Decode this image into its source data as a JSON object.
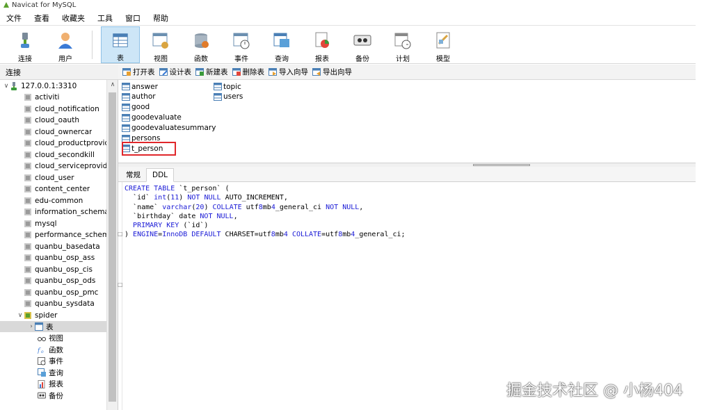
{
  "window": {
    "title": "Navicat for MySQL"
  },
  "menu": [
    "文件",
    "查看",
    "收藏夹",
    "工具",
    "窗口",
    "帮助"
  ],
  "toolbar": {
    "buttons": [
      {
        "label": "连接",
        "icon": "connect-icon"
      },
      {
        "label": "用户",
        "icon": "user-icon"
      },
      {
        "label": "表",
        "icon": "table-icon",
        "active": true
      },
      {
        "label": "视图",
        "icon": "view-icon"
      },
      {
        "label": "函数",
        "icon": "function-icon"
      },
      {
        "label": "事件",
        "icon": "event-icon"
      },
      {
        "label": "查询",
        "icon": "query-icon"
      },
      {
        "label": "报表",
        "icon": "report-icon"
      },
      {
        "label": "备份",
        "icon": "backup-icon"
      },
      {
        "label": "计划",
        "icon": "schedule-icon"
      },
      {
        "label": "模型",
        "icon": "model-icon"
      }
    ]
  },
  "navigator": {
    "header": "连接",
    "connection": "127.0.0.1:3310",
    "databases": [
      "activiti",
      "cloud_notification",
      "cloud_oauth",
      "cloud_ownercar",
      "cloud_productprovic",
      "cloud_secondkill",
      "cloud_serviceprovide",
      "cloud_user",
      "content_center",
      "edu-common",
      "information_schema",
      "mysql",
      "performance_schem",
      "quanbu_basedata",
      "quanbu_osp_ass",
      "quanbu_osp_cis",
      "quanbu_osp_ods",
      "quanbu_osp_pmc",
      "quanbu_sysdata"
    ],
    "open_database": "spider",
    "children": [
      {
        "label": "表",
        "icon": "table-icon"
      },
      {
        "label": "视图",
        "icon": "view-icon"
      },
      {
        "label": "函数",
        "icon": "function-icon"
      },
      {
        "label": "事件",
        "icon": "event-icon"
      },
      {
        "label": "查询",
        "icon": "query-icon"
      },
      {
        "label": "报表",
        "icon": "report-icon"
      },
      {
        "label": "备份",
        "icon": "backup-icon"
      }
    ]
  },
  "object_toolbar": [
    "打开表",
    "设计表",
    "新建表",
    "删除表",
    "导入向导",
    "导出向导"
  ],
  "tables": {
    "col1": [
      "answer",
      "author",
      "good",
      "goodevaluate",
      "goodevaluatesummary",
      "persons",
      "t_person"
    ],
    "col2": [
      "topic",
      "users"
    ],
    "highlighted": "t_person"
  },
  "tabs": [
    "常规",
    "DDL"
  ],
  "active_tab": "DDL",
  "ddl": {
    "lines": [
      "CREATE TABLE `t_person` (",
      "  `id` int(11) NOT NULL AUTO_INCREMENT,",
      "  `name` varchar(20) COLLATE utf8mb4_general_ci NOT NULL,",
      "  `birthday` date NOT NULL,",
      "  PRIMARY KEY (`id`)",
      ") ENGINE=InnoDB DEFAULT CHARSET=utf8mb4 COLLATE=utf8mb4_general_ci;"
    ]
  },
  "watermark": "掘金技术社区 @ 小杨404",
  "colors": {
    "selection": "#cde6f7",
    "highlight_border": "#e0262a",
    "keyword": "#1a1ad6"
  }
}
